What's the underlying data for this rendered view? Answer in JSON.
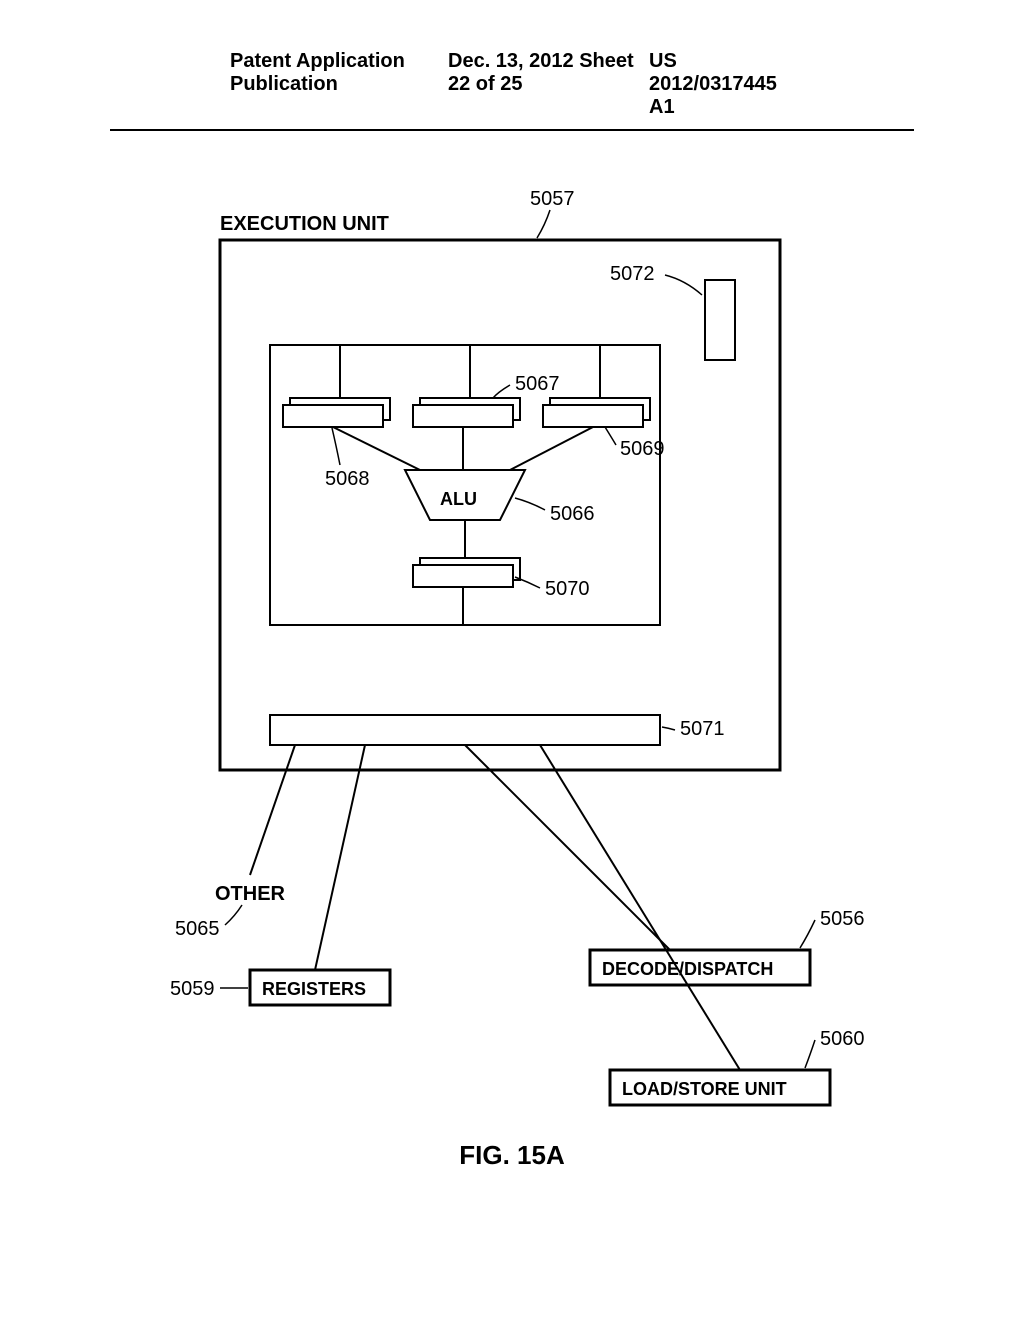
{
  "header": {
    "left": "Patent Application Publication",
    "center": "Dec. 13, 2012  Sheet 22 of 25",
    "right": "US 2012/0317445 A1"
  },
  "diagram": {
    "title": "EXECUTION UNIT",
    "alu_label": "ALU",
    "refs": {
      "r5057": "5057",
      "r5072": "5072",
      "r5067": "5067",
      "r5068": "5068",
      "r5069": "5069",
      "r5066": "5066",
      "r5070": "5070",
      "r5071": "5071",
      "r5065": "5065",
      "r5059": "5059",
      "r5056": "5056",
      "r5060": "5060"
    },
    "boxes": {
      "other": "OTHER",
      "registers": "REGISTERS",
      "decode": "DECODE/DISPATCH",
      "loadstore": "LOAD/STORE UNIT"
    },
    "figure_label": "FIG. 15A"
  }
}
